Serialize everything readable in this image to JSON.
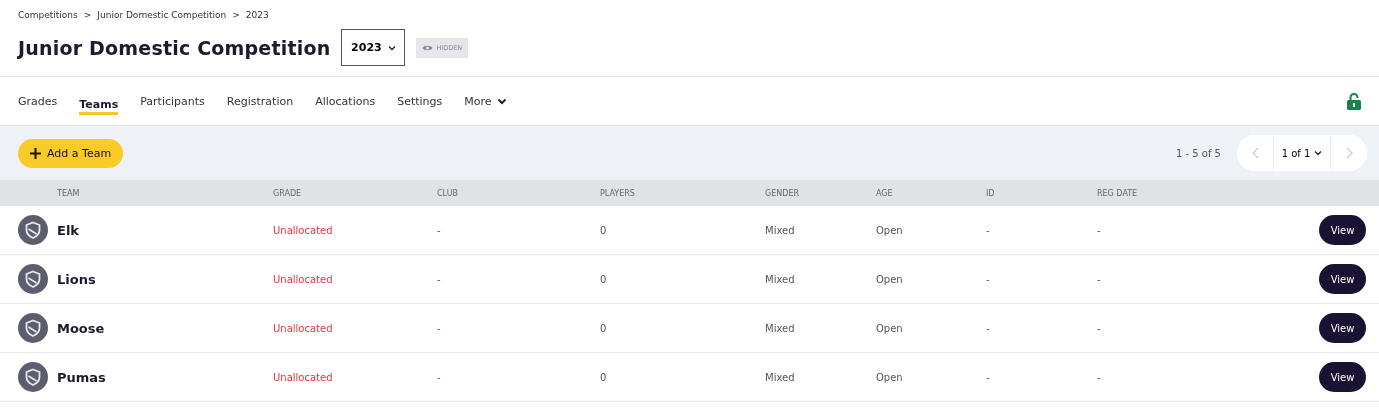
{
  "breadcrumb": [
    "Competitions",
    "Junior Domestic Competition",
    "2023"
  ],
  "breadcrumb_separator": ">",
  "title": "Junior Domestic Competition",
  "season_select": {
    "value": "2023"
  },
  "visibility_badge": "HIDDEN",
  "tabs": [
    {
      "label": "Grades",
      "selected": false
    },
    {
      "label": "Teams",
      "selected": true
    },
    {
      "label": "Participants",
      "selected": false
    },
    {
      "label": "Registration",
      "selected": false
    },
    {
      "label": "Allocations",
      "selected": false
    },
    {
      "label": "Settings",
      "selected": false
    },
    {
      "label": "More",
      "selected": false,
      "kind": "menu"
    }
  ],
  "lock": {
    "locked": false
  },
  "add_button": "Add a Team",
  "pagination": {
    "range": "1 - 5 of 5",
    "page": "1 of 1"
  },
  "table": {
    "columns": [
      "TEAM",
      "GRADE",
      "CLUB",
      "PLAYERS",
      "GENDER",
      "AGE",
      "ID",
      "REG DATE"
    ],
    "rows": [
      {
        "team": "Elk",
        "grade": "Unallocated",
        "club": "-",
        "players": "0",
        "gender": "Mixed",
        "age": "Open",
        "id": "-",
        "reg_date": "-",
        "action": "View"
      },
      {
        "team": "Lions",
        "grade": "Unallocated",
        "club": "-",
        "players": "0",
        "gender": "Mixed",
        "age": "Open",
        "id": "-",
        "reg_date": "-",
        "action": "View"
      },
      {
        "team": "Moose",
        "grade": "Unallocated",
        "club": "-",
        "players": "0",
        "gender": "Mixed",
        "age": "Open",
        "id": "-",
        "reg_date": "-",
        "action": "View"
      },
      {
        "team": "Pumas",
        "grade": "Unallocated",
        "club": "-",
        "players": "0",
        "gender": "Mixed",
        "age": "Open",
        "id": "-",
        "reg_date": "-",
        "action": "View"
      }
    ]
  }
}
